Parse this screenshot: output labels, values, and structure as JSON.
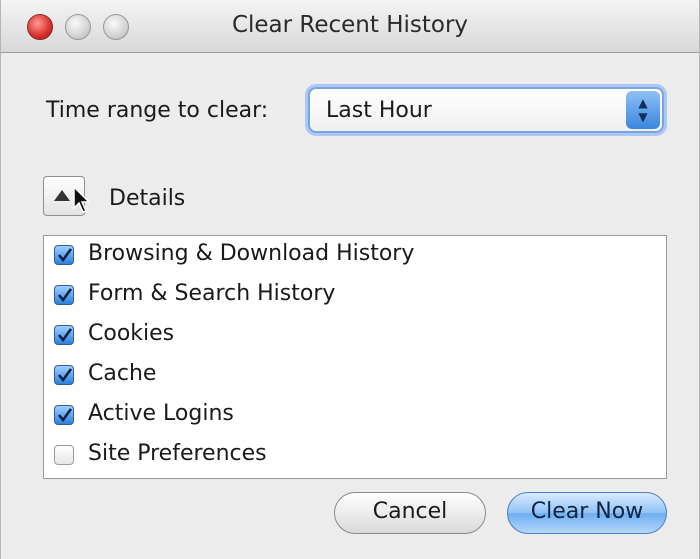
{
  "window": {
    "title": "Clear Recent History"
  },
  "time_range": {
    "label": "Time range to clear:",
    "selected": "Last Hour"
  },
  "details": {
    "label": "Details",
    "expanded": true
  },
  "items": [
    {
      "label": "Browsing & Download History",
      "checked": true
    },
    {
      "label": "Form & Search History",
      "checked": true
    },
    {
      "label": "Cookies",
      "checked": true
    },
    {
      "label": "Cache",
      "checked": true
    },
    {
      "label": "Active Logins",
      "checked": true
    },
    {
      "label": "Site Preferences",
      "checked": false
    }
  ],
  "buttons": {
    "cancel": "Cancel",
    "clear_now": "Clear Now"
  },
  "colors": {
    "accent": "#2f7fdc",
    "focus_ring": "#a9c8f5",
    "close_light": "#d8302a"
  }
}
